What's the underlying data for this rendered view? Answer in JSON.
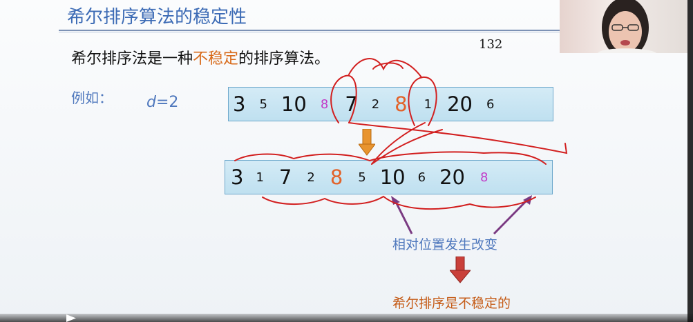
{
  "slide": {
    "title": "希尔排序算法的稳定性",
    "statement_prefix": "希尔排序法是一种",
    "statement_highlight": "不稳定",
    "statement_suffix": "的排序算法。",
    "example_label": "例如：",
    "d_var": "d",
    "d_rest": "=2",
    "annotation_handwritten": "132",
    "before": [
      {
        "v": "3",
        "size": "big",
        "color": "default"
      },
      {
        "v": "5",
        "size": "small",
        "color": "default"
      },
      {
        "v": "10",
        "size": "big",
        "color": "default"
      },
      {
        "v": "8",
        "size": "small",
        "color": "magenta"
      },
      {
        "v": "7",
        "size": "big",
        "color": "default"
      },
      {
        "v": "2",
        "size": "small",
        "color": "default"
      },
      {
        "v": "8",
        "size": "big",
        "color": "orange"
      },
      {
        "v": "1",
        "size": "small",
        "color": "default"
      },
      {
        "v": "20",
        "size": "big",
        "color": "default"
      },
      {
        "v": "6",
        "size": "small",
        "color": "default"
      }
    ],
    "after": [
      {
        "v": "3",
        "size": "big",
        "color": "default"
      },
      {
        "v": "1",
        "size": "small",
        "color": "default"
      },
      {
        "v": "7",
        "size": "big",
        "color": "default"
      },
      {
        "v": "2",
        "size": "small",
        "color": "default"
      },
      {
        "v": "8",
        "size": "big",
        "color": "orange"
      },
      {
        "v": "5",
        "size": "small",
        "color": "default"
      },
      {
        "v": "10",
        "size": "big",
        "color": "default"
      },
      {
        "v": "6",
        "size": "small",
        "color": "default"
      },
      {
        "v": "20",
        "size": "big",
        "color": "default"
      },
      {
        "v": "8",
        "size": "small",
        "color": "magenta"
      }
    ],
    "caption_change": "相对位置发生改变",
    "caption_conclusion": "希尔排序是不稳定的"
  },
  "colors": {
    "title_blue": "#3c6bb5",
    "highlight_orange": "#d86a1a",
    "magenta": "#c23ac7",
    "pen_red": "#d21f1f"
  }
}
